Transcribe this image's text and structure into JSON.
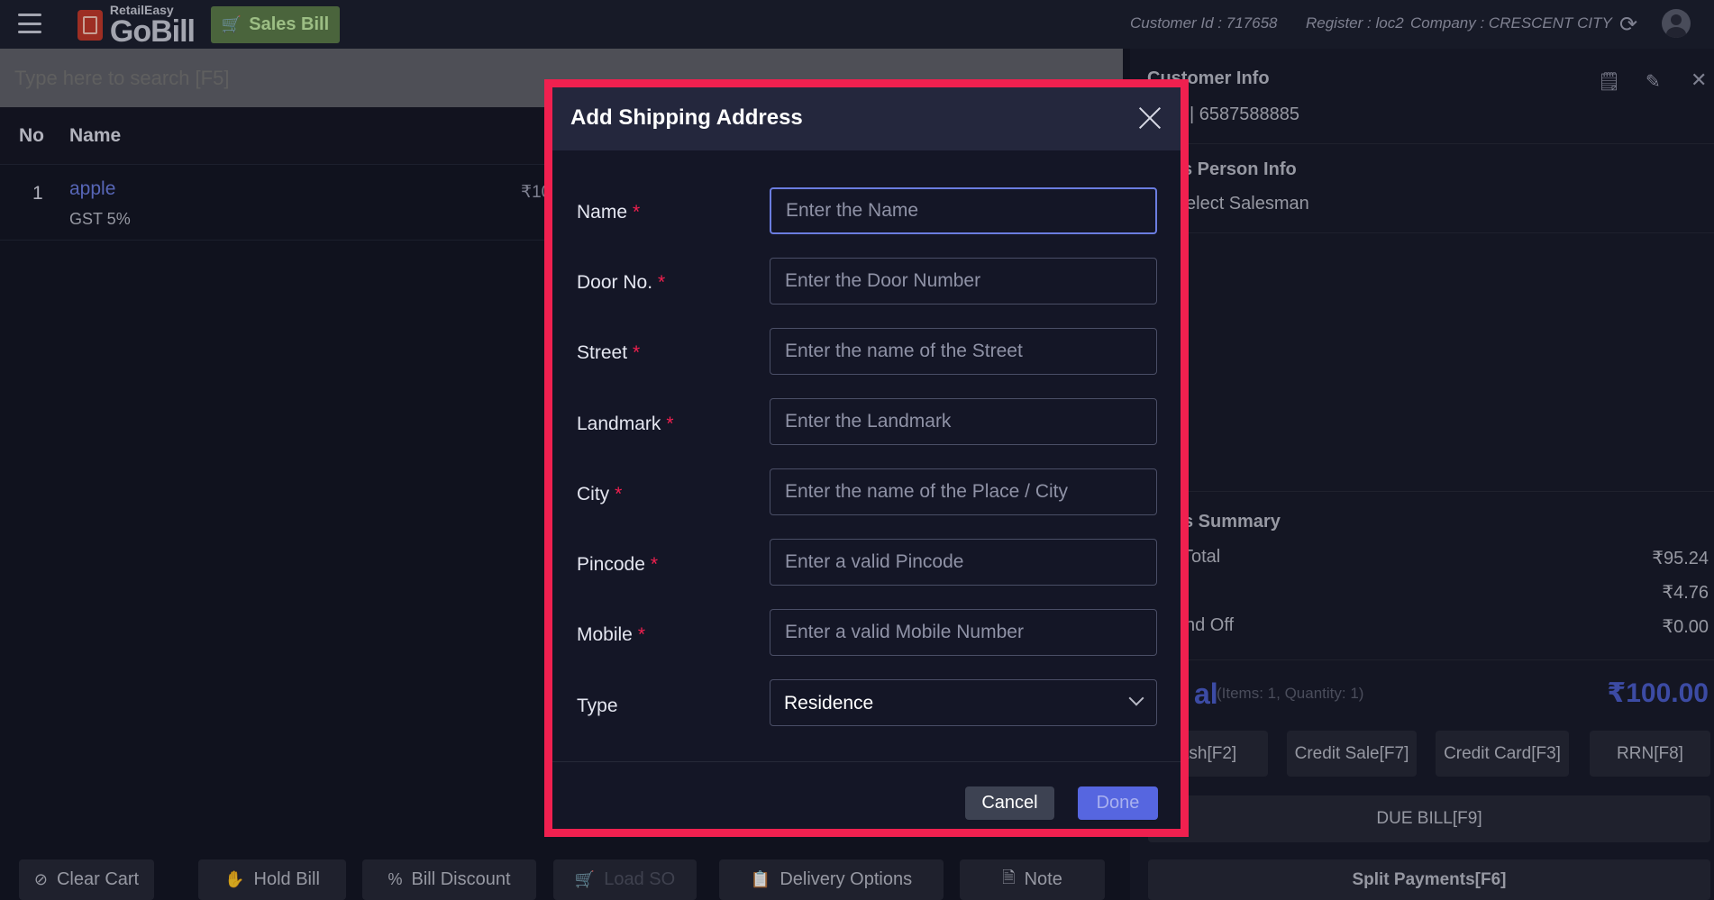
{
  "header": {
    "logo_small": "RetailEasy",
    "logo_big": "GoBill",
    "sales_bill_label": "Sales Bill",
    "customer_id": "Customer Id : 717658",
    "register": "Register : loc2",
    "company": "Company : CRESCENT CITY",
    "icons": [
      "hamburger-icon",
      "cart-icon",
      "refresh-icon",
      "user-icon"
    ]
  },
  "search": {
    "placeholder": "Type here to search [F5]"
  },
  "table": {
    "columns": [
      "No",
      "Name"
    ],
    "rows": [
      {
        "no": "1",
        "name": "apple",
        "tax": "GST 5%",
        "price": "₹10"
      }
    ]
  },
  "bottom_actions": [
    {
      "label": "Clear Cart",
      "icon": "clear-icon",
      "enabled": true
    },
    {
      "label": "Hold Bill",
      "icon": "hand-icon",
      "enabled": true
    },
    {
      "label": "Bill Discount",
      "icon": "percent-icon",
      "enabled": true
    },
    {
      "label": "Load SO",
      "icon": "cart-icon",
      "enabled": false
    },
    {
      "label": "Delivery Options",
      "icon": "clipboard-icon",
      "enabled": true
    },
    {
      "label": "Note",
      "icon": "note-icon",
      "enabled": true
    }
  ],
  "right_panel": {
    "customer_title": "Customer Info",
    "customer_phone": "| 6587588885",
    "salesperson_title": "s Person Info",
    "salesperson_value": "elect Salesman",
    "summary_title": "s Summary",
    "summary_rows": [
      {
        "label": "Total",
        "value": "₹95.24"
      },
      {
        "label": "",
        "value": "₹4.76"
      },
      {
        "label": "nd Off",
        "value": "₹0.00"
      }
    ],
    "total_label": "al",
    "total_sub": "(Items: 1, Quantity: 1)",
    "total_value": "₹100.00",
    "pay_buttons": [
      "ash[F2]",
      "Credit Sale[F7]",
      "Credit Card[F3]",
      "RRN[F8]"
    ],
    "due_bill": "DUE BILL[F9]",
    "split_payments": "Split Payments[F6]"
  },
  "modal": {
    "title": "Add Shipping Address",
    "fields": [
      {
        "label": "Name",
        "placeholder": "Enter the Name",
        "required": true
      },
      {
        "label": "Door No.",
        "placeholder": "Enter the Door Number",
        "required": true
      },
      {
        "label": "Street",
        "placeholder": "Enter the name of the Street",
        "required": true
      },
      {
        "label": "Landmark",
        "placeholder": "Enter the Landmark",
        "required": true
      },
      {
        "label": "City",
        "placeholder": "Enter the name of the Place / City",
        "required": true
      },
      {
        "label": "Pincode",
        "placeholder": "Enter a valid Pincode",
        "required": true
      },
      {
        "label": "Mobile",
        "placeholder": "Enter a valid Mobile Number",
        "required": true
      }
    ],
    "type_label": "Type",
    "type_value": "Residence",
    "required_mark": "*",
    "cancel_label": "Cancel",
    "done_label": "Done",
    "highlight_color": "#f0204f",
    "accent_color": "#5666e0"
  }
}
